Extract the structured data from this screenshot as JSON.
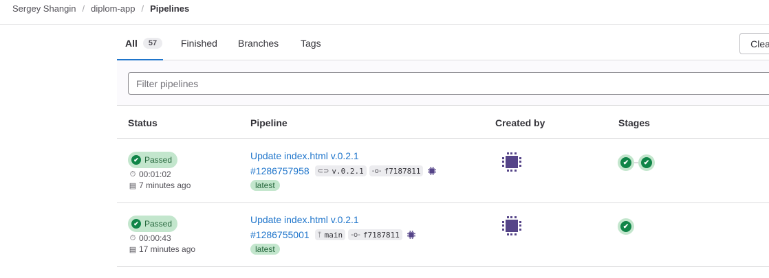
{
  "breadcrumb": {
    "items": [
      "Sergey Shangin",
      "diplom-app",
      "Pipelines"
    ],
    "separator": "/"
  },
  "tabs": [
    {
      "label": "All",
      "count": "57",
      "active": true
    },
    {
      "label": "Finished"
    },
    {
      "label": "Branches"
    },
    {
      "label": "Tags"
    }
  ],
  "clear_button": "Clea",
  "filter": {
    "placeholder": "Filter pipelines"
  },
  "columns": [
    "Status",
    "Pipeline",
    "Created by",
    "Stages"
  ],
  "pipelines": [
    {
      "status": "Passed",
      "duration": "00:01:02",
      "created": "7 minutes ago",
      "title": "Update index.html v.0.2.1",
      "id": "#1286757958",
      "ref_icon": "tag-icon",
      "ref": "v.0.2.1",
      "commit": "f7187811",
      "badge": "latest",
      "stages": [
        "passed",
        "passed"
      ]
    },
    {
      "status": "Passed",
      "duration": "00:00:43",
      "created": "17 minutes ago",
      "title": "Update index.html v.0.2.1",
      "id": "#1286755001",
      "ref_icon": "branch-icon",
      "ref": "main",
      "commit": "f7187811",
      "badge": "latest",
      "stages": [
        "passed"
      ]
    }
  ],
  "colors": {
    "link": "#1f75cb",
    "success": "#108548",
    "success_bg": "#c3e6cd",
    "avatar": "#554488"
  }
}
